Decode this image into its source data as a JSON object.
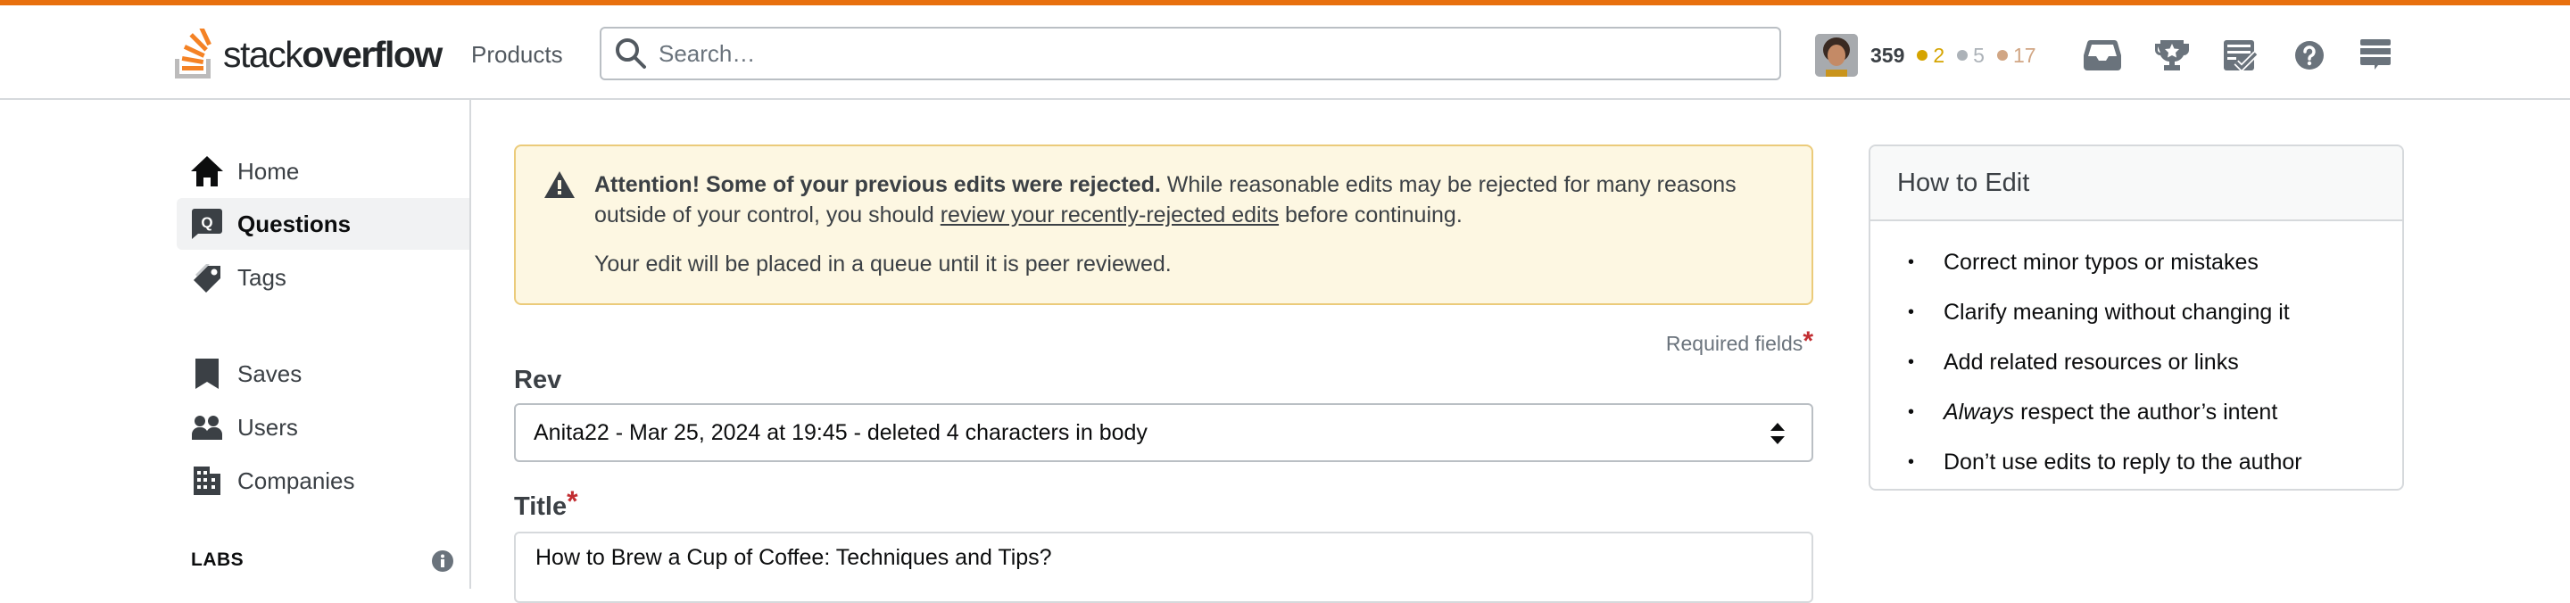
{
  "header": {
    "logo_text_light": "stack",
    "logo_text_bold": "overflow",
    "products_label": "Products",
    "search_placeholder": "Search…",
    "user": {
      "reputation": "359",
      "gold_badges": "2",
      "silver_badges": "5",
      "bronze_badges": "17"
    },
    "icons": [
      "inbox-icon",
      "achievements-icon",
      "review-queues-icon",
      "help-icon",
      "site-switcher-icon"
    ]
  },
  "colors": {
    "brand_orange": "#f48225",
    "accent_bar": "#e8700e",
    "gold": "#d5a400",
    "silver": "#acb2b8",
    "bronze": "#d1a684",
    "required_star": "#c22e32",
    "notice_bg": "#fdf7e2",
    "notice_border": "#ebcb7a"
  },
  "sidebar": {
    "items": [
      {
        "label": "Home",
        "icon": "home-icon",
        "active": false
      },
      {
        "label": "Questions",
        "icon": "questions-icon",
        "active": true
      },
      {
        "label": "Tags",
        "icon": "tag-icon",
        "active": false
      },
      {
        "label": "Saves",
        "icon": "bookmark-icon",
        "active": false
      },
      {
        "label": "Users",
        "icon": "users-icon",
        "active": false
      },
      {
        "label": "Companies",
        "icon": "building-icon",
        "active": false
      }
    ],
    "labs_label": "LABS"
  },
  "notice": {
    "bold": "Attention! Some of your previous edits were rejected.",
    "text_before_link": " While reasonable edits may be rejected for many reasons outside of your control, you should ",
    "link_text": "review your recently-rejected edits",
    "text_after_link": " before continuing.",
    "queue_text": "Your edit will be placed in a queue until it is peer reviewed."
  },
  "form": {
    "required_label": "Required fields",
    "required_star": "*",
    "rev_label": "Rev",
    "rev_value": "Anita22 - Mar 25, 2024 at 19:45 - deleted 4 characters in body",
    "title_label": "Title",
    "title_star": "*",
    "title_value": "How to Brew a Cup of Coffee: Techniques and Tips?"
  },
  "how_to_edit": {
    "title": "How to Edit",
    "items": [
      {
        "em": "",
        "text": "Correct minor typos or mistakes"
      },
      {
        "em": "",
        "text": "Clarify meaning without changing it"
      },
      {
        "em": "",
        "text": "Add related resources or links"
      },
      {
        "em": "Always",
        "text": " respect the author’s intent"
      },
      {
        "em": "",
        "text": "Don’t use edits to reply to the author"
      }
    ]
  }
}
